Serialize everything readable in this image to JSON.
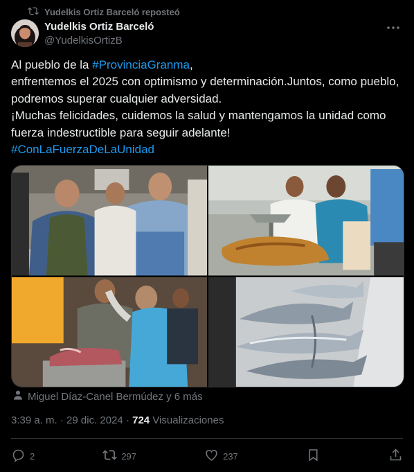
{
  "repost": {
    "text": "Yudelkis Ortiz Barceló reposteó",
    "icon": "repost-icon"
  },
  "author": {
    "name": "Yudelkis Ortiz Barceló",
    "handle": "@YudelkisOrtizB",
    "avatar": "avatar"
  },
  "post": {
    "line1_prefix": "Al pueblo de la ",
    "hashtag1": "#ProvinciaGranma",
    "line1_suffix": ",",
    "line2": "enfrentemos el 2025 con optimismo y determinación.Juntos, como pueblo, podremos superar cualquier adversidad.",
    "line3": "¡Muchas felicidades, cuidemos la salud y mantengamos la unidad como fuerza indestructible para seguir adelante!",
    "hashtag2": "#ConLaFuerzaDeLaUnidad"
  },
  "media": {
    "images": [
      "photo-people-street",
      "photo-roast-pig-stall",
      "photo-meat-market",
      "photo-fish"
    ]
  },
  "tagged": {
    "text": "Miguel Díaz-Canel Bermúdez y 6 más",
    "icon": "person-icon"
  },
  "meta": {
    "time": "3:39 a. m.",
    "sep": " · ",
    "date": "29 dic. 2024",
    "views_count": "724",
    "views_label": " Visualizaciones"
  },
  "actions": {
    "replies": "2",
    "reposts": "297",
    "likes": "237"
  },
  "colors": {
    "background": "#000000",
    "text": "#e7e9ea",
    "muted": "#71767b",
    "link": "#1d9bf0",
    "border": "#2f3336"
  }
}
